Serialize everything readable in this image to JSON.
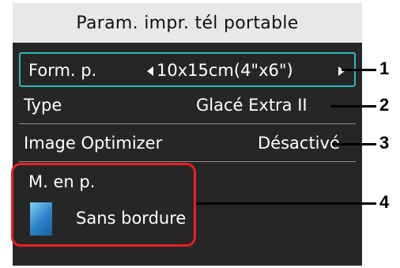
{
  "screen": {
    "title": "Param. impr. tél portable"
  },
  "settings": [
    {
      "id": "paper-size",
      "label": "Form. p.",
      "value": "10x15cm(4\"x6\")"
    },
    {
      "id": "media-type",
      "label": "Type",
      "value": "Glacé Extra II"
    },
    {
      "id": "image-optimizer",
      "label": "Image Optimizer",
      "value": "Désactivé"
    }
  ],
  "layout": {
    "label": "M. en p.",
    "value": "Sans bordure",
    "icon": "borderless-layout-icon"
  },
  "callouts": [
    "1",
    "2",
    "3",
    "4"
  ],
  "colors": {
    "screen_bg": "#262626",
    "title_bg": "#e8e8e8",
    "selection": "#2fb8c2",
    "highlight_outline": "#ee1c24",
    "icon_blue": "#2a82c6"
  }
}
